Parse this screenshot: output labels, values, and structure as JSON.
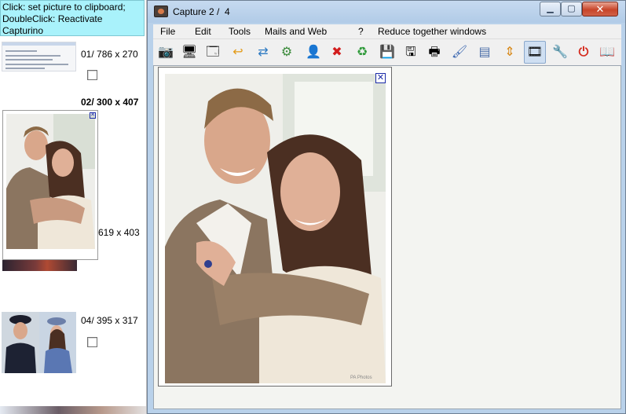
{
  "left_panel": {
    "hint_line1": "Click: set picture to clipboard;",
    "hint_line2": "DoubleClick: Reactivate Capturino",
    "thumbs": [
      {
        "label": "01/  786 x 270"
      },
      {
        "label": "02/  300 x 407"
      },
      {
        "label": "619 x 403"
      },
      {
        "label": "04/  395 x 317"
      }
    ]
  },
  "window": {
    "title": "Capture 2 /  4",
    "min_glyph": "▁",
    "max_glyph": "▢",
    "close_glyph": "✕"
  },
  "menu": {
    "file": "File",
    "edit": "Edit",
    "tools": "Tools",
    "mails": "Mails and Web",
    "help": "?",
    "reduce": "Reduce together windows"
  },
  "toolbar": [
    {
      "icon": "camera-icon",
      "glyph": "📷"
    },
    {
      "icon": "screen-capture-icon",
      "glyph": "🖥"
    },
    {
      "icon": "window-capture-icon",
      "glyph": "🗔"
    },
    {
      "icon": "undo-arrow-icon",
      "glyph": "↩"
    },
    {
      "icon": "share-icon",
      "glyph": "⇄"
    },
    {
      "icon": "network-icon",
      "glyph": "⚙"
    },
    {
      "icon": "user-icon",
      "glyph": "👤"
    },
    {
      "icon": "delete-icon",
      "glyph": "✖"
    },
    {
      "icon": "recycle-icon",
      "glyph": "♻"
    },
    {
      "icon": "save-icon",
      "glyph": "💾"
    },
    {
      "icon": "save-as-icon",
      "glyph": "🖫"
    },
    {
      "icon": "print-icon",
      "glyph": "🖶"
    },
    {
      "icon": "paint-icon",
      "glyph": "🖌"
    },
    {
      "icon": "window-list-icon",
      "glyph": "▤"
    },
    {
      "icon": "arrange-icon",
      "glyph": "⇕"
    },
    {
      "icon": "filmstrip-icon",
      "glyph": "🎞"
    },
    {
      "icon": "settings-tools-icon",
      "glyph": "🔧"
    },
    {
      "icon": "power-icon",
      "glyph": "⏻"
    },
    {
      "icon": "help-book-icon",
      "glyph": "📖"
    }
  ],
  "preview": {
    "close_glyph": "✕",
    "watermark": "PA Photos"
  },
  "colors": {
    "hint_bg": "#a9f2fb",
    "window_frame": "#b9d1ea",
    "close_red": "#c8452a",
    "delete_red": "#d21d1d"
  }
}
